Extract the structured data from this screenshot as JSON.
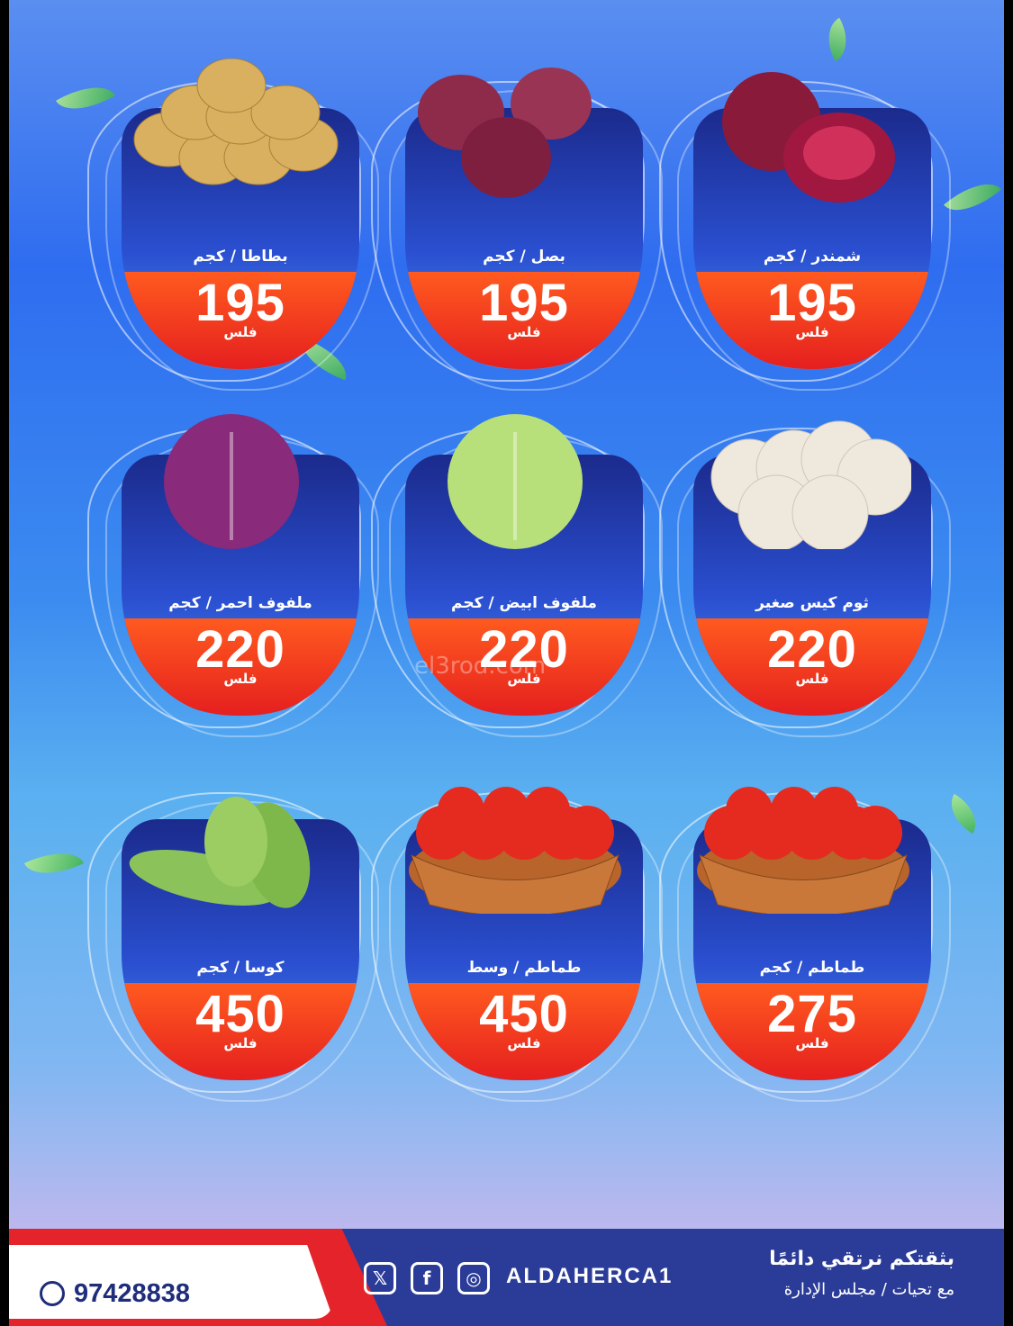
{
  "products": [
    {
      "name": "شمندر / كجم",
      "price": "195",
      "unit": "فلس",
      "icon": "beetroot-icon",
      "color": "#8a1a3a"
    },
    {
      "name": "بصل / كجم",
      "price": "195",
      "unit": "فلس",
      "icon": "onion-icon",
      "color": "#8e2a4a"
    },
    {
      "name": "بطاطا / كجم",
      "price": "195",
      "unit": "فلس",
      "icon": "potato-icon",
      "color": "#d8b060"
    },
    {
      "name": "ثوم كيس صغير",
      "price": "220",
      "unit": "فلس",
      "icon": "garlic-icon",
      "color": "#efe8dc"
    },
    {
      "name": "ملفوف ابيض / كجم",
      "price": "220",
      "unit": "فلس",
      "icon": "white-cabbage-icon",
      "color": "#b7e07a"
    },
    {
      "name": "ملفوف احمر / كجم",
      "price": "220",
      "unit": "فلس",
      "icon": "red-cabbage-icon",
      "color": "#8a2a7a"
    },
    {
      "name": "طماطم / كجم",
      "price": "275",
      "unit": "فلس",
      "icon": "tomato-basket-icon",
      "color": "#e52a20"
    },
    {
      "name": "طماطم / وسط",
      "price": "450",
      "unit": "فلس",
      "icon": "tomato-basket-icon",
      "color": "#e52a20"
    },
    {
      "name": "كوسا / كجم",
      "price": "450",
      "unit": "فلس",
      "icon": "zucchini-icon",
      "color": "#7fb84a"
    }
  ],
  "footer": {
    "phone": "97428838",
    "handle": "ALDAHERCA1",
    "slogan": "بثقتكم نرتقي دائمًا",
    "sub": "مع تحيات / مجلس الإدارة"
  },
  "watermark": "el3rod.com",
  "colors": {
    "accent_red": "#e4242a",
    "navy": "#2b3c98",
    "price_orange": "#ff5a1f"
  }
}
